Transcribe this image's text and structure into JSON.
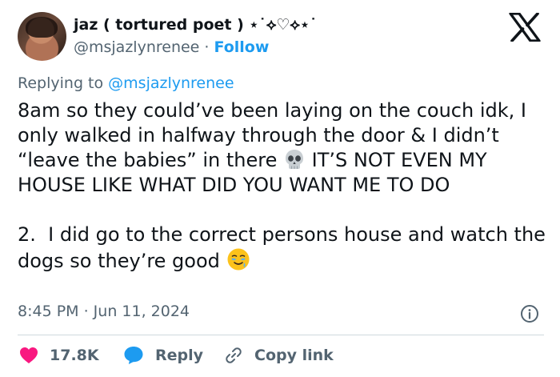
{
  "author": {
    "display_name": "jaz ( tortured poet ) ⋆˙⟡♡⟡⋆˙",
    "handle": "@msjazlynrenee",
    "separator": " · ",
    "follow_label": "Follow"
  },
  "reply_context": {
    "prefix": "Replying to ",
    "mention": "@msjazlynrenee"
  },
  "tweet": {
    "part1": "8am so they could’ve been laying on the couch idk, I only walked in halfway through the door & I didn’t “leave the babies” in there ",
    "part2": " IT’S NOT EVEN MY HOUSE LIKE WHAT DID YOU WANT ME TO DO\n\n2.  I did go to the correct persons house and watch the dogs so they’re good ",
    "emoji1": "skull-emoji",
    "emoji2": "face-holding-back-tears-emoji"
  },
  "timestamp": "8:45 PM · Jun 11, 2024",
  "actions": {
    "like_count": "17.8K",
    "reply_label": "Reply",
    "copy_label": "Copy link"
  },
  "colors": {
    "accent": "#1d9bf0",
    "like": "#f91880",
    "muted": "#536471"
  }
}
